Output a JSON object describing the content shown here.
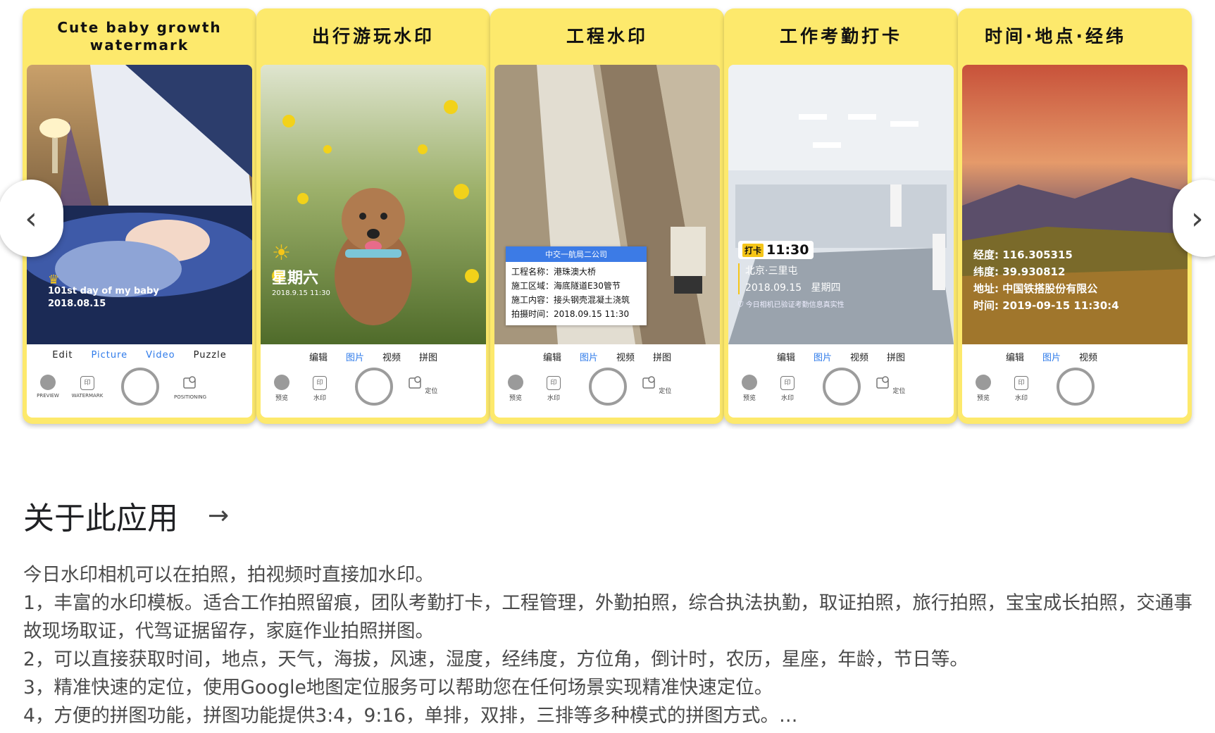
{
  "cards": [
    {
      "title": "Cute baby growth\nwatermark",
      "tabs": [
        "Edit",
        "Picture",
        "Video",
        "Puzzle"
      ],
      "controls": {
        "preview": "PREVIEW",
        "watermark": "WATERMARK",
        "positioning": "POSITIONING"
      },
      "overlay": {
        "line1": "101st day of my baby",
        "line2": "2018.08.15"
      }
    },
    {
      "title": "出行游玩水印",
      "tabs": [
        "编辑",
        "图片",
        "视频",
        "拼图"
      ],
      "controls": {
        "preview": "预览",
        "watermark": "水印",
        "positioning": "定位"
      },
      "overlay": {
        "line1": "星期六",
        "line2": "2018.9.15 11:30"
      }
    },
    {
      "title": "工程水印",
      "tabs": [
        "编辑",
        "图片",
        "视频",
        "拼图"
      ],
      "controls": {
        "preview": "预览",
        "watermark": "水印",
        "positioning": "定位"
      },
      "overlay": {
        "header": "中交一航局二公司",
        "rows": [
          "工程名称：港珠澳大桥",
          "施工区域：海底隧道E30管节",
          "施工内容：接头钢壳混凝土浇筑",
          "拍摄时间：2018.09.15 11:30"
        ]
      }
    },
    {
      "title": "工作考勤打卡",
      "tabs": [
        "编辑",
        "图片",
        "视频",
        "拼图"
      ],
      "controls": {
        "preview": "预览",
        "watermark": "水印",
        "positioning": "定位"
      },
      "overlay": {
        "badge": "打卡",
        "time": "11:30",
        "place": "北京·三里屯",
        "date": "2018.09.15   星期四",
        "verify": "今日相机已验证考勤信息真实性"
      }
    },
    {
      "title": "时间·地点·经纬",
      "tabs": [
        "编辑",
        "图片",
        "视频"
      ],
      "controls": {
        "preview": "预览",
        "watermark": "水印"
      },
      "overlay": {
        "rows": [
          "经度: 116.305315",
          "纬度: 39.930812",
          "地址: 中国铁搭股份有限公",
          "时间: 2019-09-15 11:30:4"
        ]
      }
    }
  ],
  "nav": {
    "prev": "‹",
    "next": "›"
  },
  "about": {
    "title": "关于此应用",
    "arrow": "→"
  },
  "description": "今日水印相机可以在拍照，拍视频时直接加水印。\n1，丰富的水印模板。适合工作拍照留痕，团队考勤打卡，工程管理，外勤拍照，综合执法执勤，取证拍照，旅行拍照，宝宝成长拍照，交通事故现场取证，代驾证据留存，家庭作业拍照拼图。\n2，可以直接获取时间，地点，天气，海拔，风速，湿度，经纬度，方位角，倒计时，农历，星座，年龄，节日等。\n3，精准快速的定位，使用Google地图定位服务可以帮助您在任何场景实现精准快速定位。\n4，方便的拼图功能，拼图功能提供3:4，9:16，单排，双排，三排等多种模式的拼图方式。…",
  "colors": {
    "card_bg": "#fde96c",
    "active_tab": "#2f7bea",
    "text": "#202124",
    "muted": "#4a4a4a"
  }
}
